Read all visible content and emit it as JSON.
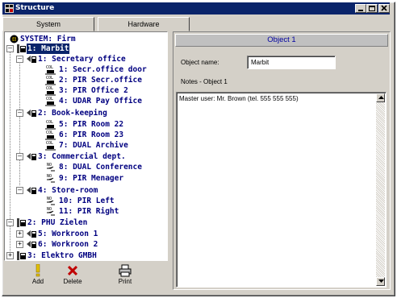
{
  "window": {
    "title": "Structure"
  },
  "tabs": [
    {
      "label": "System"
    },
    {
      "label": "Hardware"
    }
  ],
  "tree": {
    "root_label": "SYSTEM: Firm",
    "nodes": [
      {
        "label": "1: Marbit",
        "selected": true
      },
      {
        "label": "1: Secretary office"
      },
      {
        "label": "1: Secr.office door",
        "type": "COL"
      },
      {
        "label": "2: PIR Secr.office",
        "type": "COL"
      },
      {
        "label": "3: PIR Office 2",
        "type": "COL"
      },
      {
        "label": "4: UDAR Pay Office",
        "type": "COL"
      },
      {
        "label": "2: Book-keeping"
      },
      {
        "label": "5: PIR Room 22",
        "type": "COL"
      },
      {
        "label": "6: PIR Room 23",
        "type": "COL"
      },
      {
        "label": "7: DUAL Archive",
        "type": "COL"
      },
      {
        "label": "3: Commercial dept."
      },
      {
        "label": "8: DUAL Conference",
        "type": "NO"
      },
      {
        "label": "9: PIR Menager",
        "type": "NO"
      },
      {
        "label": "4: Store-room"
      },
      {
        "label": "10: PIR Left",
        "type": "NO"
      },
      {
        "label": "11: PIR Right",
        "type": "NO"
      },
      {
        "label": "2: PHU Zielen"
      },
      {
        "label": "5: Workroon 1"
      },
      {
        "label": "6: Workroon 2"
      },
      {
        "label": "3: Elektro GMBH"
      }
    ],
    "icon_tags": {
      "col": "COL",
      "no": "NO"
    }
  },
  "toolbar": {
    "add_label": "Add",
    "delete_label": "Delete",
    "print_label": "Print"
  },
  "details": {
    "header": "Object 1",
    "object_name_label": "Object name:",
    "object_name_value": "Marbit",
    "notes_label": "Notes - Object 1",
    "notes_value": "Master user: Mr. Brown (tel. 555 555 555)"
  },
  "colors": {
    "titlebar": "#0a246a",
    "tree_text": "#000080",
    "header_text": "#0000a0",
    "delete_icon": "#c00000",
    "add_icon": "#e0c000"
  }
}
